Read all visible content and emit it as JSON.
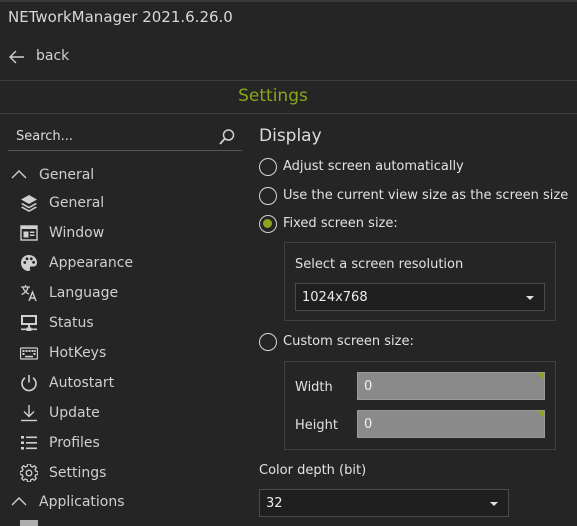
{
  "window": {
    "title": "NETworkManager 2021.6.26.0"
  },
  "nav": {
    "back_label": "back"
  },
  "page": {
    "title": "Settings"
  },
  "sidebar": {
    "search_placeholder": "Search...",
    "groups": [
      {
        "label": "General"
      },
      {
        "label": "Applications"
      }
    ],
    "items": [
      {
        "label": "General",
        "icon": "layers-icon"
      },
      {
        "label": "Window",
        "icon": "window-icon"
      },
      {
        "label": "Appearance",
        "icon": "palette-icon"
      },
      {
        "label": "Language",
        "icon": "translate-icon"
      },
      {
        "label": "Status",
        "icon": "monitor-network-icon"
      },
      {
        "label": "HotKeys",
        "icon": "keyboard-icon"
      },
      {
        "label": "Autostart",
        "icon": "power-icon"
      },
      {
        "label": "Update",
        "icon": "download-icon"
      },
      {
        "label": "Profiles",
        "icon": "list-icon"
      },
      {
        "label": "Settings",
        "icon": "gear-icon"
      }
    ]
  },
  "display": {
    "title": "Display",
    "options": [
      {
        "label": "Adjust screen automatically",
        "checked": false
      },
      {
        "label": "Use the current view size as the screen size",
        "checked": false
      },
      {
        "label": "Fixed screen size:",
        "checked": true
      },
      {
        "label": "Custom screen size:",
        "checked": false
      }
    ],
    "resolution_label": "Select a screen resolution",
    "resolution_value": "1024x768",
    "width_label": "Width",
    "width_value": "0",
    "height_label": "Height",
    "height_value": "0",
    "color_depth_label": "Color depth (bit)",
    "color_depth_value": "32"
  },
  "colors": {
    "accent": "#8aa61c",
    "background": "#252525"
  }
}
